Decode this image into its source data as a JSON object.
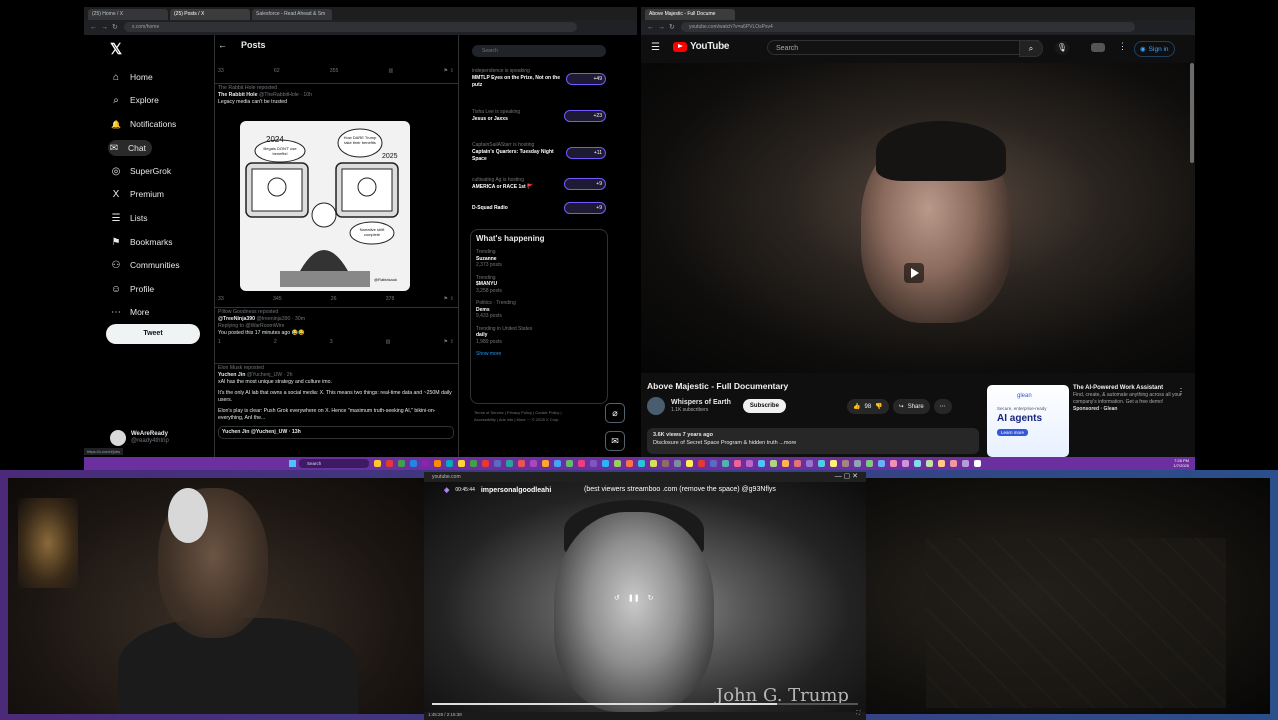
{
  "x": {
    "tabs": [
      "(25) Home / X",
      "(25) Posts / X",
      "Salesforce - Read Ahead & Sm"
    ],
    "url": "x.com/home",
    "nav": [
      {
        "label": "Home",
        "icon": "home-icon",
        "glyph": "⌂"
      },
      {
        "label": "Explore",
        "icon": "search-icon",
        "glyph": "⌕"
      },
      {
        "label": "Notifications",
        "icon": "bell-icon",
        "glyph": "🔔"
      },
      {
        "label": "Chat",
        "icon": "chat-icon",
        "glyph": "✉"
      },
      {
        "label": "SuperGrok",
        "icon": "grok-icon",
        "glyph": "◎"
      },
      {
        "label": "Premium",
        "icon": "x-premium-icon",
        "glyph": "X"
      },
      {
        "label": "Lists",
        "icon": "lists-icon",
        "glyph": "☰"
      },
      {
        "label": "Bookmarks",
        "icon": "bookmark-icon",
        "glyph": "⚑"
      },
      {
        "label": "Communities",
        "icon": "communities-icon",
        "glyph": "⚇"
      },
      {
        "label": "Profile",
        "icon": "profile-icon",
        "glyph": "☺"
      },
      {
        "label": "More",
        "icon": "more-icon",
        "glyph": "⋯"
      }
    ],
    "tweet_button": "Tweet",
    "profile": {
      "name": "WeAreReady",
      "handle": "@ready4thtrip"
    },
    "feed_title": "Posts",
    "posts": [
      {
        "repost": "The Rabbit Hole reposted",
        "author": "The Rabbit Hole",
        "handle": "@TheRabbitHole · 10h",
        "text": "Legacy media can't be trusted",
        "stats": [
          "33",
          "345",
          "26",
          "378"
        ]
      },
      {
        "repost": "Pillow Goodness reposted",
        "author": "@TreeNinja390",
        "handle": "@treeninja390 · 30m",
        "text": "Replying to @WarRoomWire",
        "text2": "You posted this 17 minutes ago 😂😂",
        "stats": [
          "1",
          "2",
          "3",
          ""
        ]
      },
      {
        "repost": "Elon Musk reposted",
        "author": "Yuchen Jin",
        "handle": "@Yuchenj_UW · 2h",
        "text": "xAI has the most unique strategy and culture imo.",
        "text2": "It's the only AI lab that owns a social media: X. This means two things: real-time data and ~250M daily users.",
        "text3": "Elon's play is clear: Push Grok everywhere on X. Hence \"maximum truth-seeking AI,\" bikini-on-everything, AnI the...",
        "quote": "Yuchen Jin @Yuchenj_UW · 13h"
      }
    ],
    "first_stats": [
      "33",
      "62",
      "355",
      ""
    ],
    "comic": {
      "panel_left": "Illegals DON'T use benefits!",
      "panel_right": "How DARE Trump take their benefits",
      "year_left": "2024",
      "year_right": "2025",
      "bubble": "Narrative shift complete",
      "sign": "@Rabidsauk"
    },
    "search_placeholder": "Search",
    "spaces": [
      {
        "host": "independence is speaking",
        "title": "MMTLP Eyes on the Prize, Not on the putz",
        "count": "+49"
      },
      {
        "host": "Tisha Lee is speaking",
        "title": "Jesus or Jaxxs",
        "count": "+23"
      },
      {
        "host": "CaptainSailAStarr is hosting",
        "title": "Captain's Quarters: Tuesday Night Space",
        "count": "+11"
      },
      {
        "host": "cultivating Ag is hosting",
        "title": "AMERICA or RACE 1st 🚩",
        "count": "+9"
      },
      {
        "host": "",
        "title": "D-Squad Radio",
        "count": "+9"
      }
    ],
    "happening_title": "What's happening",
    "trends": [
      {
        "cat": "Trending",
        "name": "Suzanne",
        "count": "2,373 posts"
      },
      {
        "cat": "Trending",
        "name": "$MANYU",
        "count": "3,258 posts"
      },
      {
        "cat": "Politics · Trending",
        "name": "Dems",
        "count": "9,433 posts"
      },
      {
        "cat": "Trending in United States",
        "name": "daily",
        "count": "1,989 posts"
      }
    ],
    "show_more": "Show more",
    "footer": "Terms of Service | Privacy Policy | Cookie Policy | Accessibility | Ads info | More ··· © 2025 X Corp.",
    "status_url": "https://x.com/i/jobs"
  },
  "youtube": {
    "tab": "Above Majestic - Full Docume",
    "url": "youtube.com/watch?v=a6PVLOsPsv4",
    "search_placeholder": "Search",
    "signin": "Sign in",
    "logo": "YouTube",
    "title": "Above Majestic - Full Documentary",
    "channel": "Whispers of Earth",
    "subscribers": "1.1K subscribers",
    "subscribe": "Subscribe",
    "likes": "98",
    "share": "Share",
    "views": "3.6K views",
    "age": "7 years ago",
    "description": "Disclosure of Secret Space Program & hidden truth ...more",
    "ad": {
      "brand": "glean",
      "headline": "AI agents",
      "tagline": "Secure, enterprise-ready",
      "title": "The AI-Powered Work Assistant",
      "desc": "Find, create, & automate anything across all your company's information. Get a free demo!",
      "sponsor": "Sponsored · Glean",
      "cta": "Learn more"
    }
  },
  "taskbar": {
    "search": "Search",
    "time": "7:28 PM",
    "date": "1/7/2025"
  },
  "overlay": {
    "site": "youtube.com",
    "user": "impersonalgoodleahi",
    "timer": "00:45:44",
    "notice": "(best viewers streamboo .com (remove the space) @g93Nflys",
    "caption": "John G. Trump",
    "time": "1:45:28 / 2:15:38",
    "progress": 0.81
  }
}
